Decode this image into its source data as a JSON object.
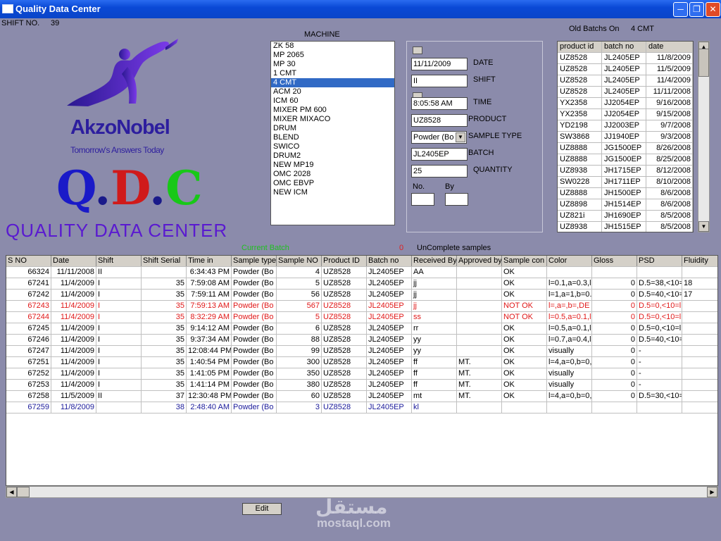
{
  "window": {
    "title": "Quality Data Center"
  },
  "shift": {
    "label": "SHIFT NO.",
    "value": "39"
  },
  "logo": {
    "name": "AkzoNobel",
    "tagline": "Tomorrow's Answers Today",
    "qdc_letters": [
      "Q",
      ".",
      "D",
      ".",
      "C"
    ],
    "app_title": "QUALITY DATA CENTER",
    "colors": {
      "brand": "#2d1e9e",
      "q": "#1a1ac8",
      "d": "#d01a1a",
      "c": "#18c818",
      "title": "#5a1ad0"
    }
  },
  "machine": {
    "label": "MACHINE",
    "items": [
      "ZK 58",
      "MP 2065",
      "MP 30",
      "1 CMT",
      "4 CMT",
      "ACM 20",
      "ICM 60",
      "MIXER PM 600",
      "MIXER MIXACO",
      "DRUM",
      "BLEND",
      "SWICO",
      "DRUM2",
      "NEW MP19",
      "OMC 2028",
      "OMC EBVP",
      "NEW ICM"
    ],
    "selected": "4 CMT"
  },
  "form": {
    "date_label": "DATE",
    "date_value": "11/11/2009",
    "shift_label": "SHIFT",
    "shift_value": "II",
    "time_label": "TIME",
    "time_value": "8:05:58 AM",
    "product_label": "PRODUCT",
    "product_value": "UZ8528",
    "sample_type_label": "SAMPLE TYPE",
    "sample_type_value": "Powder (Bo",
    "batch_label": "BATCH",
    "batch_value": "JL2405EP",
    "quantity_label": "QUANTITY",
    "quantity_value": "25",
    "no_label": "No.",
    "no_value": "",
    "by_label": "By",
    "by_value": ""
  },
  "old_batchs": {
    "title": "Old Batchs On",
    "machine": "4 CMT",
    "columns": [
      "product id",
      "batch no",
      "date"
    ],
    "rows": [
      [
        "UZ8528",
        "JL2405EP",
        "11/8/2009"
      ],
      [
        "UZ8528",
        "JL2405EP",
        "11/5/2009"
      ],
      [
        "UZ8528",
        "JL2405EP",
        "11/4/2009"
      ],
      [
        "UZ8528",
        "JL2405EP",
        "11/11/2008"
      ],
      [
        "YX2358",
        "JJ2054EP",
        "9/16/2008"
      ],
      [
        "YX2358",
        "JJ2054EP",
        "9/15/2008"
      ],
      [
        "YD2198",
        "JJ2003EP",
        "9/7/2008"
      ],
      [
        "SW3868",
        "JJ1940EP",
        "9/3/2008"
      ],
      [
        "UZ8888",
        "JG1500EP",
        "8/26/2008"
      ],
      [
        "UZ8888",
        "JG1500EP",
        "8/25/2008"
      ],
      [
        "UZ8938",
        "JH1715EP",
        "8/12/2008"
      ],
      [
        "SW0228",
        "JH1711EP",
        "8/10/2008"
      ],
      [
        "UZ8888",
        "JH1500EP",
        "8/6/2008"
      ],
      [
        "UZ8898",
        "JH1514EP",
        "8/6/2008"
      ],
      [
        "UZ821i",
        "JH1690EP",
        "8/5/2008"
      ],
      [
        "UZ8938",
        "JH1515EP",
        "8/5/2008"
      ]
    ]
  },
  "status": {
    "current_batch_label": "Current Batch",
    "uncomplete_count": "0",
    "uncomplete_label": "UnComplete samples"
  },
  "samples": {
    "columns": [
      "S NO",
      "Date",
      "Shift",
      "Shift Serial",
      "Time in",
      "Sample type",
      "Sample NO",
      "Product ID",
      "Batch no",
      "Received By",
      "Approved by",
      "Sample con",
      "Color",
      "Gloss",
      "PSD",
      "Fluidity"
    ],
    "rows": [
      {
        "style": "normal",
        "cells": [
          "66324",
          "11/11/2008",
          "II",
          "",
          "6:34:43 PM",
          "Powder (Bo",
          "4",
          "UZ8528",
          "JL2405EP",
          "AA",
          "",
          "OK",
          "",
          "",
          "",
          ""
        ]
      },
      {
        "style": "normal",
        "cells": [
          "67241",
          "11/4/2009",
          "I",
          "35",
          "7:59:08 AM",
          "Powder (Bo",
          "5",
          "UZ8528",
          "JL2405EP",
          "jj",
          "",
          "OK",
          "l=0.1,a=0.3,l",
          "0",
          "D.5=38,<10=",
          "18"
        ]
      },
      {
        "style": "normal",
        "cells": [
          "67242",
          "11/4/2009",
          "I",
          "35",
          "7:59:11 AM",
          "Powder (Bo",
          "56",
          "UZ8528",
          "JL2405EP",
          "jj",
          "",
          "OK",
          "l=1,a=1,b=0.",
          "0",
          "D.5=40,<10=",
          "17"
        ]
      },
      {
        "style": "red",
        "cells": [
          "67243",
          "11/4/2009",
          "I",
          "35",
          "7:59:13 AM",
          "Powder (Bo",
          "567",
          "UZ8528",
          "JL2405EP",
          "jj",
          "",
          "NOT OK",
          "l=,a=,b=,DE",
          "0",
          "D.5=0,<10=l",
          ""
        ]
      },
      {
        "style": "red",
        "cells": [
          "67244",
          "11/4/2009",
          "I",
          "35",
          "8:32:29 AM",
          "Powder (Bo",
          "5",
          "UZ8528",
          "JL2405EP",
          "ss",
          "",
          "NOT OK",
          "l=0.5,a=0.1,l",
          "0",
          "D.5=0,<10=l",
          ""
        ]
      },
      {
        "style": "normal",
        "cells": [
          "67245",
          "11/4/2009",
          "I",
          "35",
          "9:14:12 AM",
          "Powder (Bo",
          "6",
          "UZ8528",
          "JL2405EP",
          "rr",
          "",
          "OK",
          "l=0.5,a=0.1,l",
          "0",
          "D.5=0,<10=l",
          ""
        ]
      },
      {
        "style": "normal",
        "cells": [
          "67246",
          "11/4/2009",
          "I",
          "35",
          "9:37:34 AM",
          "Powder (Bo",
          "88",
          "UZ8528",
          "JL2405EP",
          "yy",
          "",
          "OK",
          "l=0.7,a=0.4,l",
          "0",
          "D.5=40,<10=",
          ""
        ]
      },
      {
        "style": "normal",
        "cells": [
          "67247",
          "11/4/2009",
          "I",
          "35",
          "12:08:44 PM",
          "Powder (Bo",
          "99",
          "UZ8528",
          "JL2405EP",
          "yy",
          "",
          "OK",
          "visually",
          "0",
          "-",
          ""
        ]
      },
      {
        "style": "normal",
        "cells": [
          "67251",
          "11/4/2009",
          "I",
          "35",
          "1:40:54 PM",
          "Powder (Bo",
          "300",
          "UZ8528",
          "JL2405EP",
          "ff",
          "MT.",
          "OK",
          "l=4,a=0,b=0,",
          "0",
          "-",
          ""
        ]
      },
      {
        "style": "normal",
        "cells": [
          "67252",
          "11/4/2009",
          "I",
          "35",
          "1:41:05 PM",
          "Powder (Bo",
          "350",
          "UZ8528",
          "JL2405EP",
          "ff",
          "MT.",
          "OK",
          "visually",
          "0",
          "-",
          ""
        ]
      },
      {
        "style": "normal",
        "cells": [
          "67253",
          "11/4/2009",
          "I",
          "35",
          "1:41:14 PM",
          "Powder (Bo",
          "380",
          "UZ8528",
          "JL2405EP",
          "ff",
          "MT.",
          "OK",
          "visually",
          "0",
          "-",
          ""
        ]
      },
      {
        "style": "normal",
        "cells": [
          "67258",
          "11/5/2009",
          "II",
          "37",
          "12:30:48 PM",
          "Powder (Bo",
          "60",
          "UZ8528",
          "JL2405EP",
          "mt",
          "MT.",
          "OK",
          "l=4,a=0,b=0,",
          "0",
          "D.5=30,<10=",
          ""
        ]
      },
      {
        "style": "blue",
        "cells": [
          "67259",
          "11/8/2009",
          "",
          "38",
          "2:48:40 AM",
          "Powder (Bo",
          "3",
          "UZ8528",
          "JL2405EP",
          "kl",
          "",
          "",
          "",
          "",
          "",
          ""
        ]
      }
    ]
  },
  "actions": {
    "edit_label": "Edit"
  },
  "watermark": {
    "text": "مستقل",
    "sub": "mostaql.com"
  },
  "icons": {
    "minimize": "minimize-icon",
    "maximize": "maximize-icon",
    "close": "close-icon",
    "dropdown": "chevron-down-icon",
    "scroll_up": "arrow-up-icon",
    "scroll_down": "arrow-down-icon",
    "scroll_left": "arrow-left-icon",
    "scroll_right": "arrow-right-icon"
  }
}
